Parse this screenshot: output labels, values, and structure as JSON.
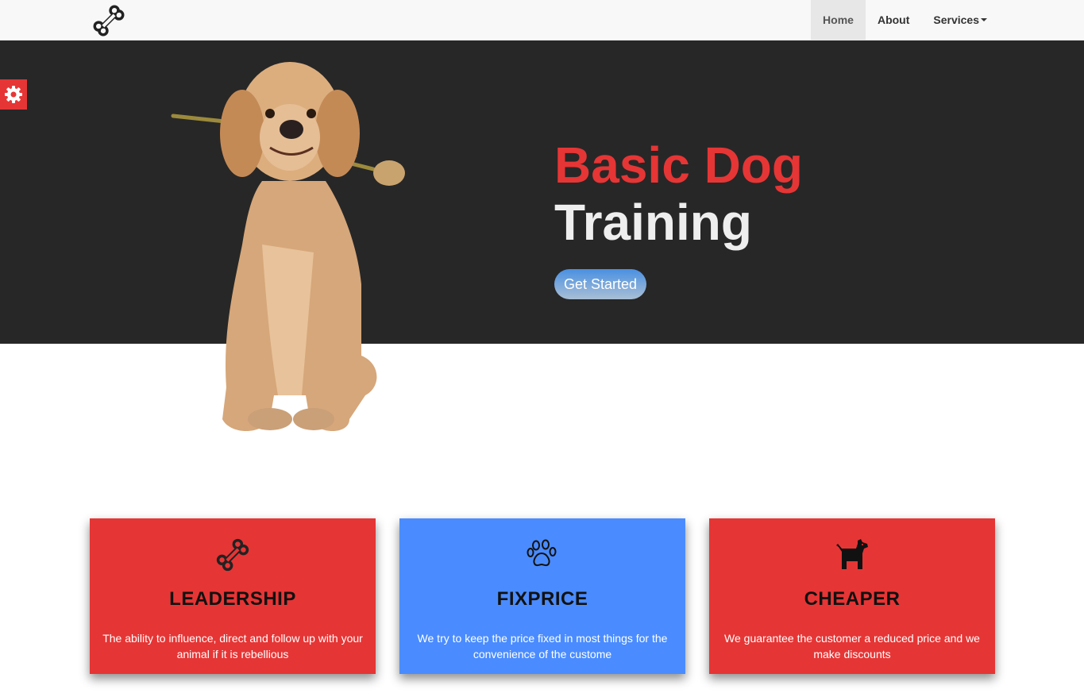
{
  "nav": {
    "items": [
      {
        "label": "Home",
        "active": true
      },
      {
        "label": "About",
        "active": false
      },
      {
        "label": "Services",
        "active": false,
        "dropdown": true
      }
    ],
    "brand_icon": "bone-icon"
  },
  "settings": {
    "icon": "gear-icon"
  },
  "hero": {
    "title_line1": "Basic Dog",
    "title_line2": "Training",
    "cta_label": "Get Started",
    "image": "dog-with-flower"
  },
  "cards": [
    {
      "icon": "bone-icon",
      "title": "LEADERSHIP",
      "text": "The ability to influence, direct and follow up with your animal if it is rebellious",
      "color": "#e63535"
    },
    {
      "icon": "paw-icon",
      "title": "FIXPRICE",
      "text": "We try to keep the price fixed in most things for the convenience of the custome",
      "color": "#4a8cff"
    },
    {
      "icon": "dog-icon",
      "title": "CHEAPER",
      "text": "We guarantee the customer a reduced price and we make discounts",
      "color": "#e63535"
    }
  ],
  "colors": {
    "accent_red": "#e63535",
    "accent_blue": "#4a8cff",
    "hero_bg": "#272727"
  }
}
